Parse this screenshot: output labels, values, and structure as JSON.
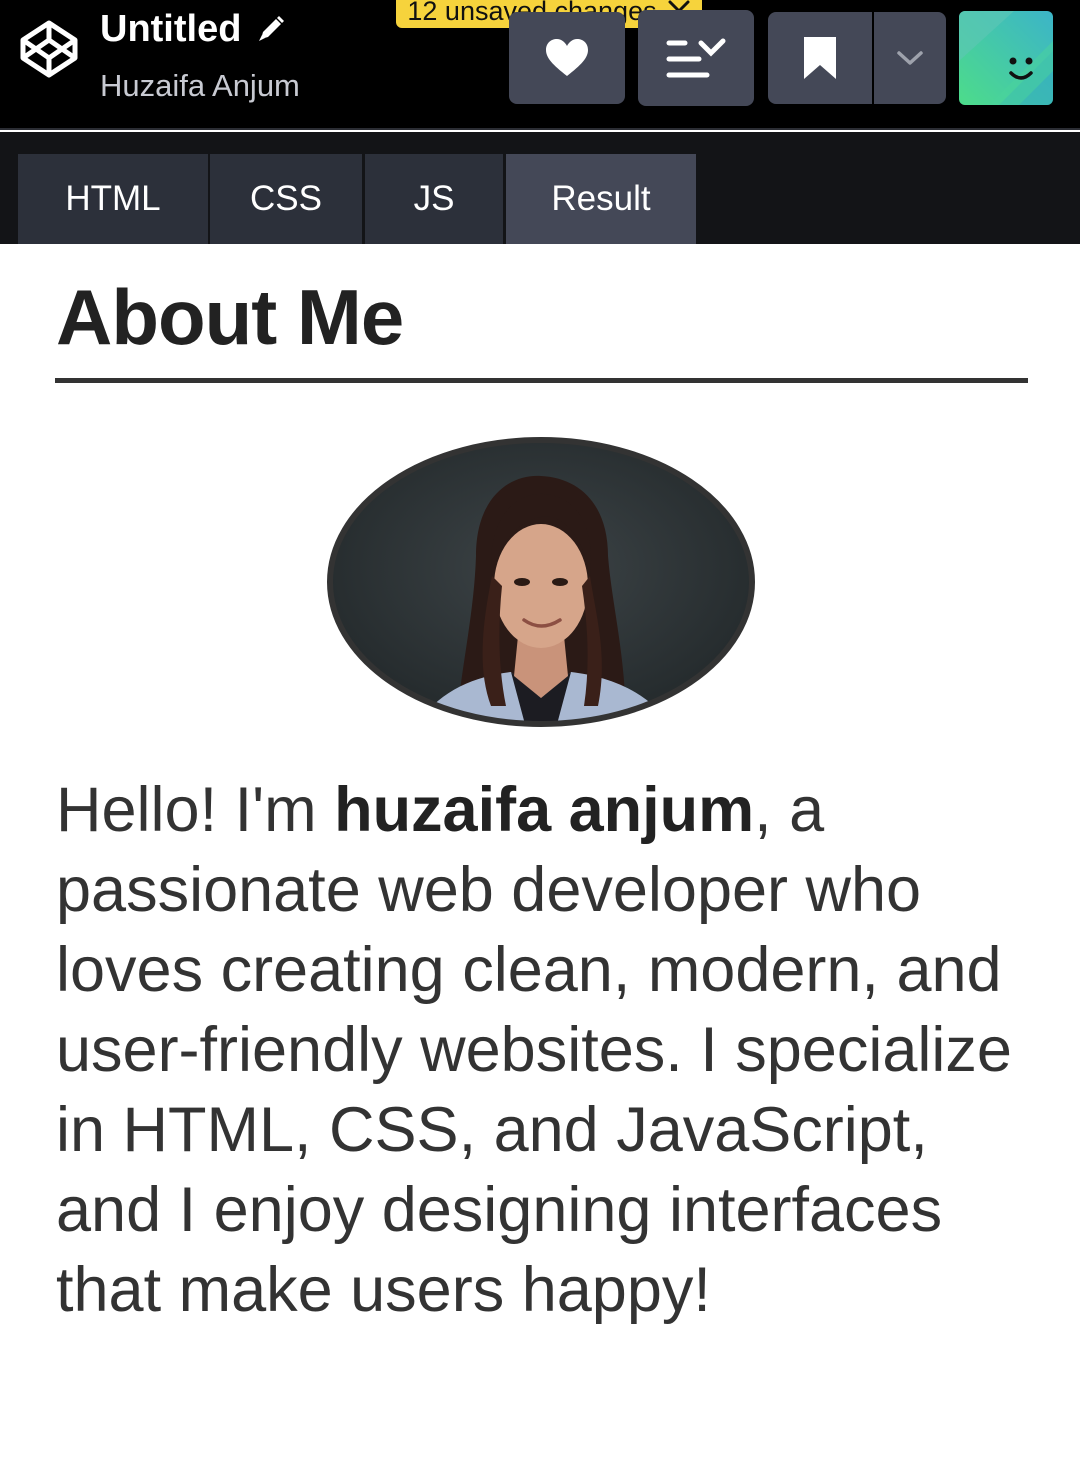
{
  "header": {
    "title": "Untitled",
    "author": "Huzaifa Anjum",
    "unsaved_notice": "12 unsaved changes",
    "icons": {
      "logo": "codepen-logo-icon",
      "edit": "pencil-icon",
      "close": "close-icon",
      "like": "heart-icon",
      "layout": "change-view-icon",
      "save": "bookmark-icon",
      "more": "chevron-down-icon",
      "avatar": "smiley-avatar-icon"
    }
  },
  "tabs": [
    {
      "label": "HTML",
      "active": false
    },
    {
      "label": "CSS",
      "active": false
    },
    {
      "label": "JS",
      "active": false
    },
    {
      "label": "Result",
      "active": true
    }
  ],
  "result": {
    "heading": "About Me",
    "bio_intro": "Hello! I'm ",
    "bio_name": "huzaifa anjum",
    "bio_rest": ", a passionate web developer who loves creating clean, modern, and user-friendly websites. I specialize in HTML, CSS, and JavaScript, and I enjoy designing interfaces that make users happy!"
  },
  "colors": {
    "topbar_bg": "#000000",
    "button_bg": "#444857",
    "tab_bg": "#2c303a",
    "active_tab_bg": "#444857",
    "notice_bg": "#f6d33c",
    "avatar_teal": "#3ecf9f"
  }
}
